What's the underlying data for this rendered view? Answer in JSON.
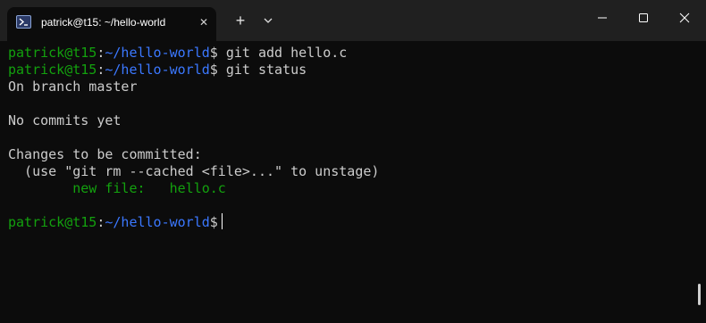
{
  "window": {
    "tab_title": "patrick@t15: ~/hello-world",
    "tab_icon": "powershell-terminal-icon",
    "new_tab_label": "+",
    "close_tab_label": "✕"
  },
  "terminal": {
    "prompt_user_host": "patrick@t15",
    "prompt_colon": ":",
    "prompt_path": "~/hello-world",
    "prompt_symbol": "$",
    "lines": [
      {
        "type": "command",
        "command": " git add hello.c"
      },
      {
        "type": "command",
        "command": " git status"
      },
      {
        "type": "output",
        "text": "On branch master"
      },
      {
        "type": "output",
        "text": "No commits yet"
      },
      {
        "type": "output",
        "text": "Changes to be committed:"
      },
      {
        "type": "output",
        "text": "  (use \"git rm --cached <file>...\" to unstage)"
      },
      {
        "type": "staged",
        "text": "        new file:   hello.c"
      },
      {
        "type": "command",
        "command": " "
      }
    ]
  },
  "colors": {
    "background": "#0c0c0c",
    "titlebar": "#202020",
    "user_host": "#13a10e",
    "path": "#3b78ff",
    "text": "#cccccc",
    "staged": "#13a10e"
  }
}
